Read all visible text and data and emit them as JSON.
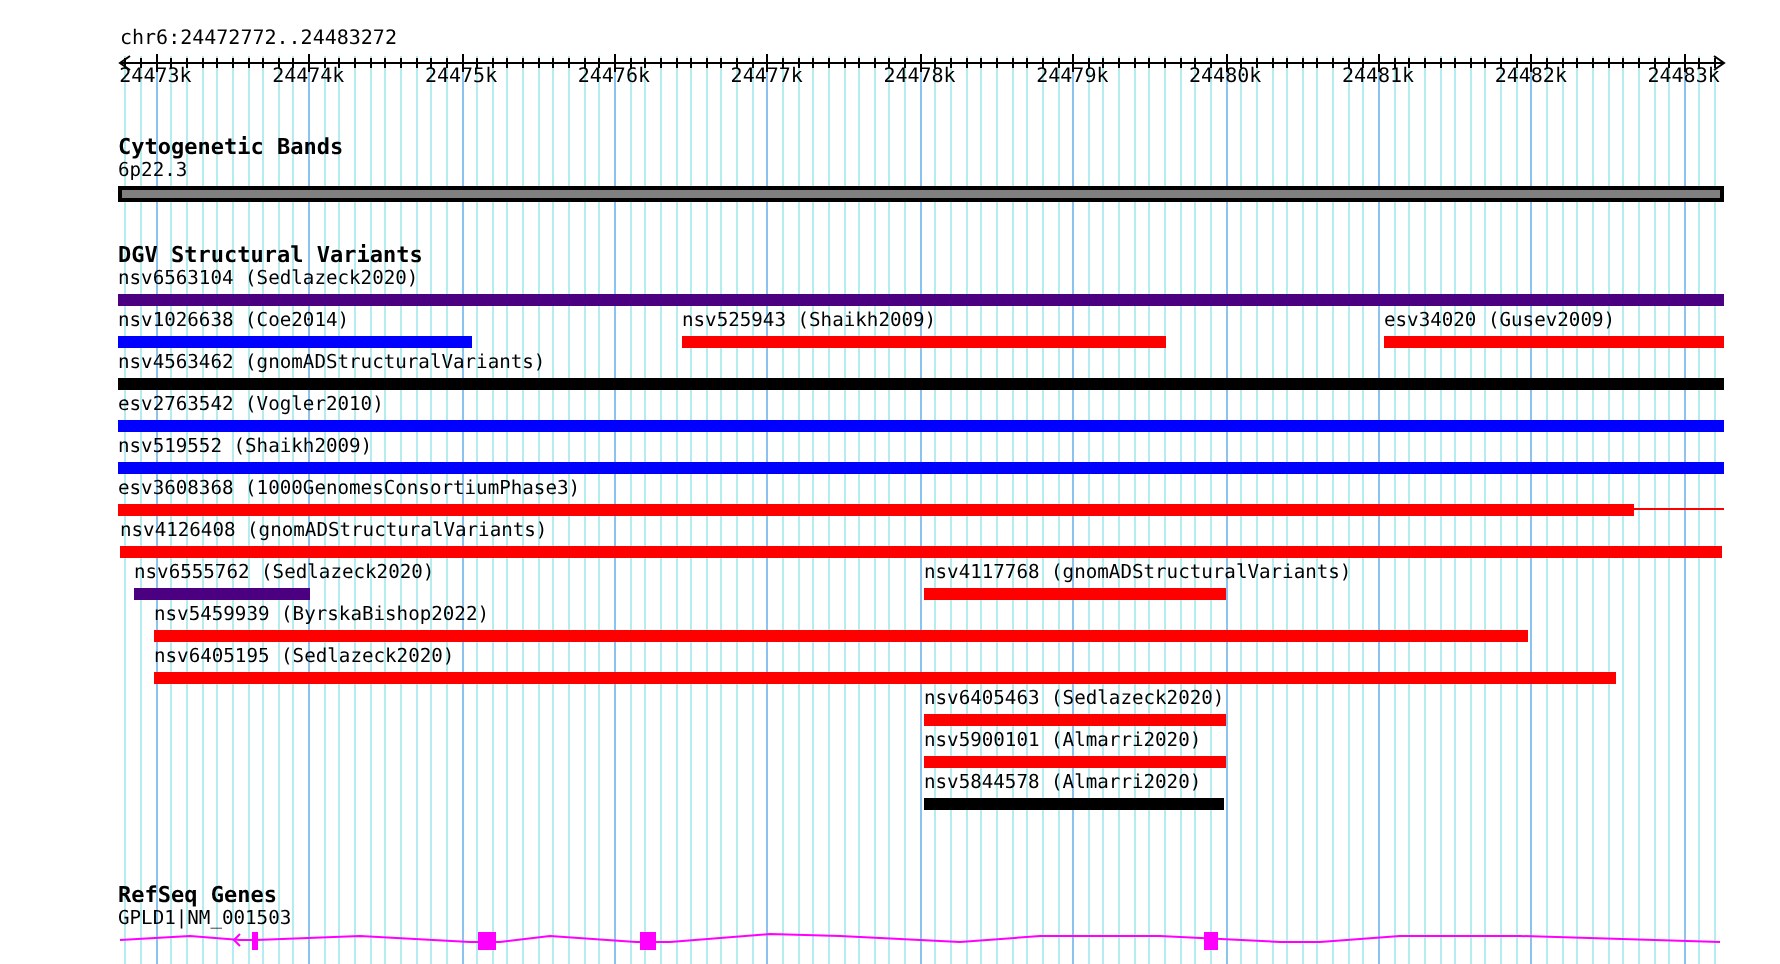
{
  "ruler": {
    "location": "chr6:24472772..24483272",
    "ticks": [
      "24473k",
      "24474k",
      "24475k",
      "24476k",
      "24477k",
      "24478k",
      "24479k",
      "24480k",
      "24481k",
      "24482k",
      "24483k"
    ]
  },
  "tracks": [
    {
      "kind": "band",
      "title": "Cytogenetic Bands",
      "features": [
        {
          "label": "6p22.3",
          "color": "#808080"
        }
      ]
    },
    {
      "kind": "variant",
      "title": "DGV Structural Variants",
      "features": [
        {
          "label": "nsv6563104 (Sedlazeck2020)",
          "color": "#4b0082"
        },
        {
          "label": "nsv1026638 (Coe2014)",
          "color": "#0000ff"
        },
        {
          "label": "nsv525943 (Shaikh2009)",
          "color": "#ff0000"
        },
        {
          "label": "esv34020 (Gusev2009)",
          "color": "#ff0000"
        },
        {
          "label": "nsv4563462 (gnomADStructuralVariants)",
          "color": "#000000"
        },
        {
          "label": "esv2763542 (Vogler2010)",
          "color": "#0000ff"
        },
        {
          "label": "nsv519552 (Shaikh2009)",
          "color": "#0000ff"
        },
        {
          "label": "esv3608368 (1000GenomesConsortiumPhase3)",
          "color": "#ff0000"
        },
        {
          "label": "nsv4126408 (gnomADStructuralVariants)",
          "color": "#ff0000"
        },
        {
          "label": "nsv6555762 (Sedlazeck2020)",
          "color": "#4b0082"
        },
        {
          "label": "nsv4117768 (gnomADStructuralVariants)",
          "color": "#ff0000"
        },
        {
          "label": "nsv5459939 (ByrskaBishop2022)",
          "color": "#ff0000"
        },
        {
          "label": "nsv6405195 (Sedlazeck2020)",
          "color": "#ff0000"
        },
        {
          "label": "nsv6405463 (Sedlazeck2020)",
          "color": "#ff0000"
        },
        {
          "label": "nsv5900101 (Almarri2020)",
          "color": "#ff0000"
        },
        {
          "label": "nsv5844578 (Almarri2020)",
          "color": "#000000"
        }
      ]
    },
    {
      "kind": "gene",
      "title": "RefSeq Genes",
      "features": [
        {
          "label": "GPLD1|NM_001503",
          "color": "#ff00ff"
        }
      ]
    }
  ]
}
